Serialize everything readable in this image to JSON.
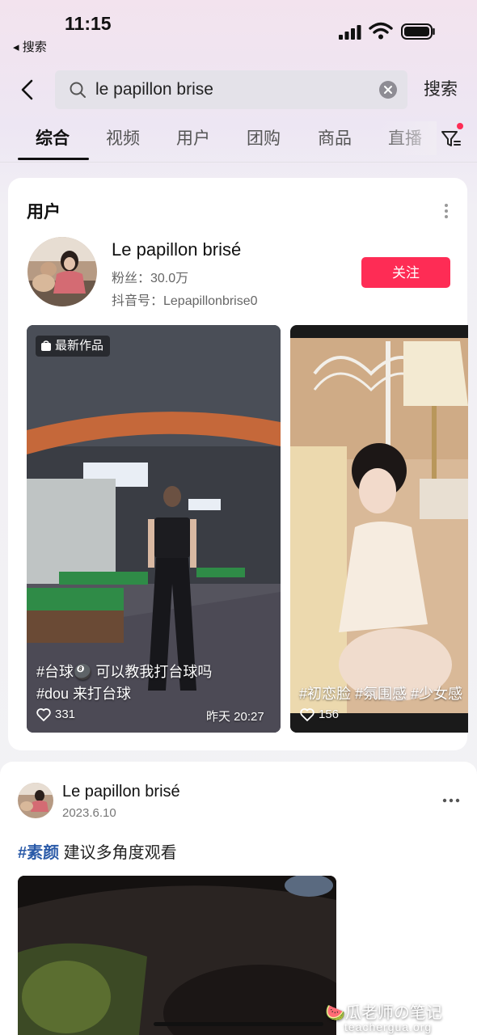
{
  "status_bar": {
    "time": "11:15",
    "back_app": "◂ 搜索"
  },
  "search": {
    "query": "le papillon brise",
    "button_label": "搜索"
  },
  "tabs": [
    {
      "label": "综合",
      "active": true
    },
    {
      "label": "视频",
      "active": false
    },
    {
      "label": "用户",
      "active": false
    },
    {
      "label": "团购",
      "active": false
    },
    {
      "label": "商品",
      "active": false
    },
    {
      "label": "直播",
      "active": false
    }
  ],
  "user_card": {
    "section_title": "用户",
    "name": "Le papillon brisé",
    "fans": "粉丝：30.0万",
    "douyin_id": "抖音号：Lepapillonbrise0",
    "follow_label": "关注",
    "videos": [
      {
        "badge": "最新作品",
        "caption_line1": "#台球🎱 可以教我打台球吗",
        "caption_line2": "#dou 来打台球",
        "likes": "331",
        "time": "昨天 20:27"
      },
      {
        "caption_line1": "#初恋脸 #氛围感 #少女感",
        "likes": "156"
      }
    ]
  },
  "post": {
    "author": "Le papillon brisé",
    "date": "2023.6.10",
    "hashtag": "#素颜",
    "text": " 建议多角度观看"
  },
  "watermark": {
    "line1": "🍉瓜老师の笔记",
    "line2": "teachergua.org"
  },
  "colors": {
    "accent": "#fe2c55",
    "hashtag": "#2a5aa8"
  }
}
